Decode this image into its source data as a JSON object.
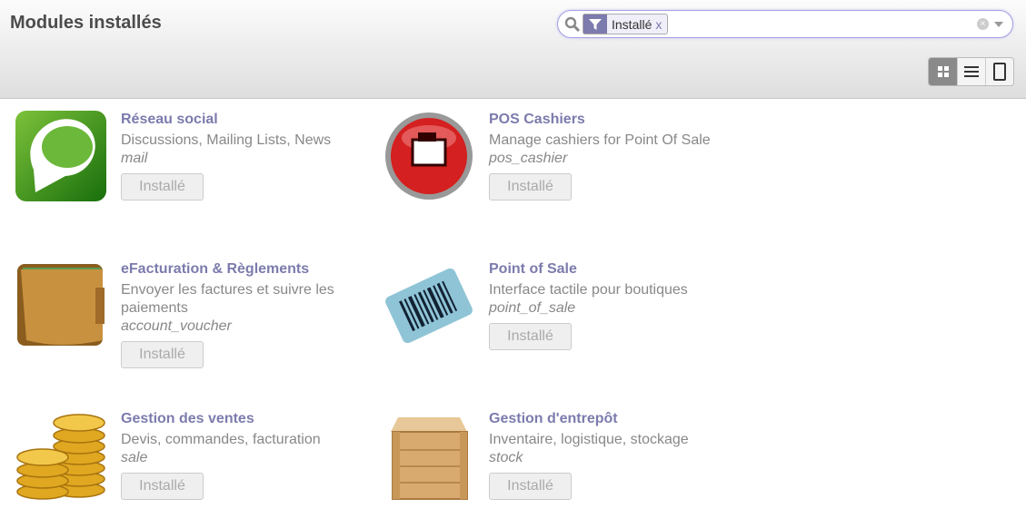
{
  "header": {
    "title": "Modules installés"
  },
  "search": {
    "facet_label": "Installé",
    "facet_remove": "x",
    "clear": "×"
  },
  "views": [
    "kanban-view",
    "list-view",
    "form-view"
  ],
  "modules": [
    {
      "name": "Réseau social",
      "desc": "Discussions, Mailing Lists, News",
      "tech": "mail",
      "button": "Installé",
      "icon": "chat-bubble-icon"
    },
    {
      "name": "POS Cashiers",
      "desc": "Manage cashiers for Point Of Sale",
      "tech": "pos_cashier",
      "button": "Installé",
      "icon": "cash-register-icon"
    },
    {
      "name": "eFacturation & Règlements",
      "desc": "Envoyer les factures et suivre les paiements",
      "tech": "account_voucher",
      "button": "Installé",
      "icon": "wallet-icon"
    },
    {
      "name": "Point of Sale",
      "desc": "Interface tactile pour boutiques",
      "tech": "point_of_sale",
      "button": "Installé",
      "icon": "barcode-icon"
    },
    {
      "name": "Gestion des ventes",
      "desc": "Devis, commandes, facturation",
      "tech": "sale",
      "button": "Installé",
      "icon": "coins-icon"
    },
    {
      "name": "Gestion d'entrepôt",
      "desc": "Inventaire, logistique, stockage",
      "tech": "stock",
      "button": "Installé",
      "icon": "crate-icon"
    }
  ]
}
